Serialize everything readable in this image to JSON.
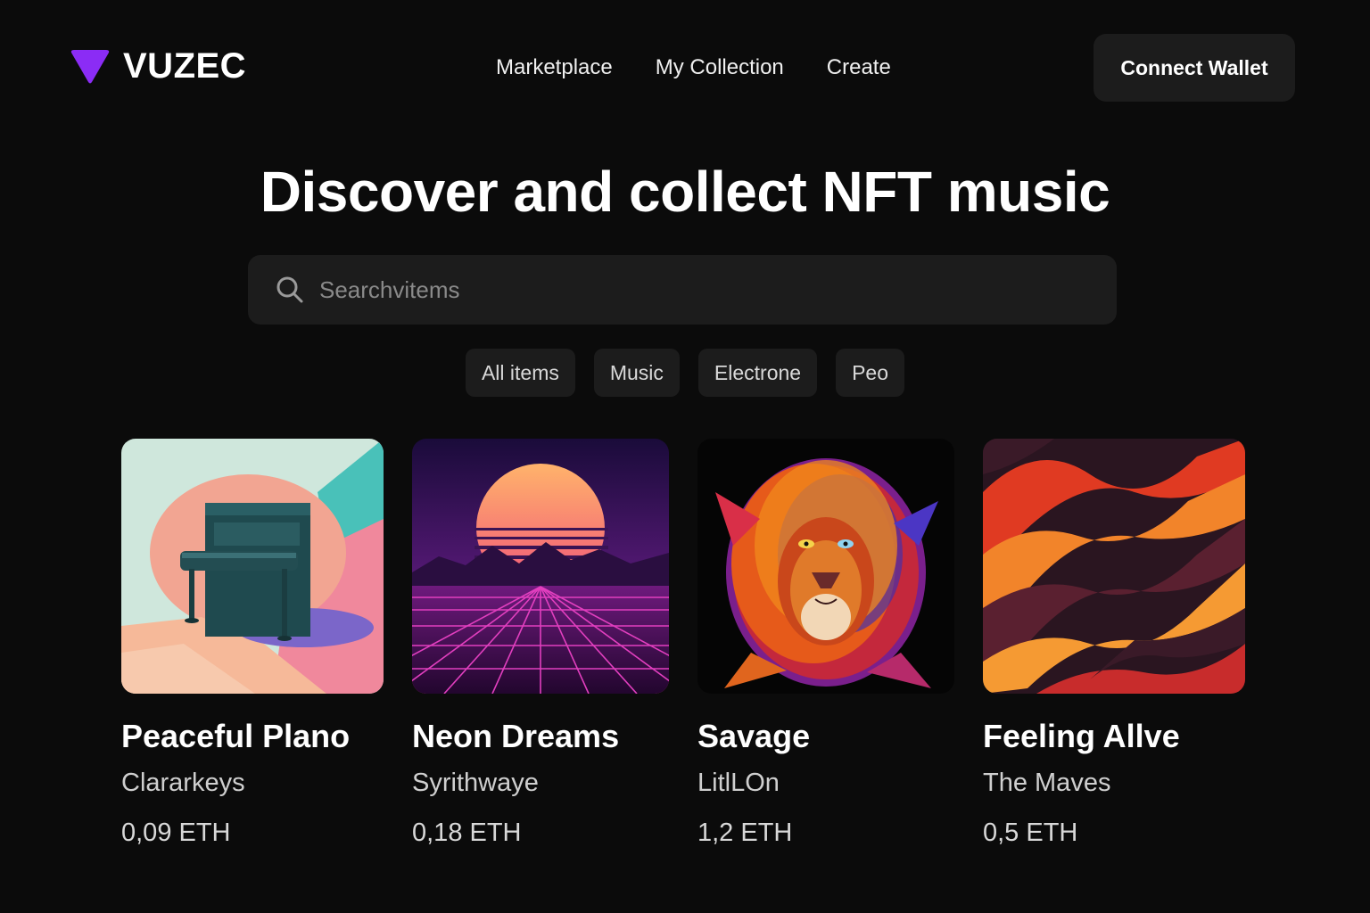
{
  "brand": {
    "name": "VUZEC",
    "logo_color": "#8b2cf5"
  },
  "nav": {
    "items": [
      "Marketplace",
      "My Collection",
      "Create"
    ]
  },
  "header": {
    "connect_label": "Connect Wallet"
  },
  "hero": {
    "title": "Discover and collect NFT music"
  },
  "search": {
    "placeholder": "Searchvitems",
    "icon": "search-icon"
  },
  "filters": [
    "All items",
    "Music",
    "Electrone",
    "Peo"
  ],
  "cards": [
    {
      "title": "Peaceful Plano",
      "artist": "Clararkeys",
      "price": "0,09 ETH",
      "art": "piano-artwork"
    },
    {
      "title": "Neon Dreams",
      "artist": "Syrithwaye",
      "price": "0,18 ETH",
      "art": "synthwave-sunset-artwork"
    },
    {
      "title": "Savage",
      "artist": "LitlLOn",
      "price": "1,2 ETH",
      "art": "neon-lion-artwork"
    },
    {
      "title": "Feeling Allve",
      "artist": "The Maves",
      "price": "0,5 ETH",
      "art": "orange-waves-artwork"
    }
  ],
  "colors": {
    "background": "#0b0b0b",
    "surface": "#1c1c1c",
    "accent": "#8b2cf5"
  }
}
